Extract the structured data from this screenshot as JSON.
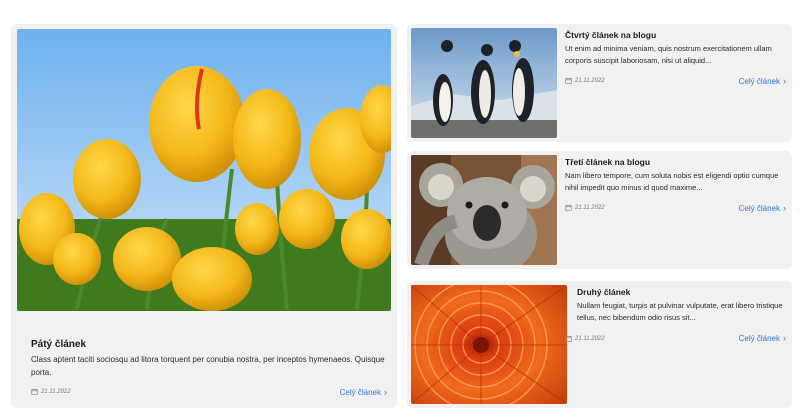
{
  "articles": [
    {
      "title": "Pátý článek",
      "excerpt": "Class aptent taciti sociosqu ad litora torquent per conubia nostra, per inceptos hymenaeos. Quisque porta.",
      "date": "21.11.2022",
      "more": "Celý článek",
      "image": "tulips-photo"
    },
    {
      "title": "Čtvrtý článek na blogu",
      "excerpt": "Ut enim ad minima veniam, quis nostrum exercitationem ullam corporis suscipit laboriosam, nisi ut aliquid...",
      "date": "21.11.2022",
      "more": "Celý článek",
      "image": "penguins-photo"
    },
    {
      "title": "Třetí článek na blogu",
      "excerpt": "Nam libero tempore, cum soluta nobis est eligendi optio cumque nihil impedit quo minus id quod maxime...",
      "date": "21.11.2022",
      "more": "Celý článek",
      "image": "koala-photo"
    },
    {
      "title": "Druhý článek",
      "excerpt": "Nullam feugiat, turpis at pulvinar vulputate, erat libero tristique tellus, nec bibendum odio risus sit...",
      "date": "21.11.2022",
      "more": "Celý článek",
      "image": "chrysanthemum-photo"
    }
  ],
  "icons": {
    "date": "calendar-icon",
    "more": "chevron-right-icon"
  },
  "colors": {
    "card_bg": "#f1f1f2",
    "link": "#2f78d6"
  }
}
